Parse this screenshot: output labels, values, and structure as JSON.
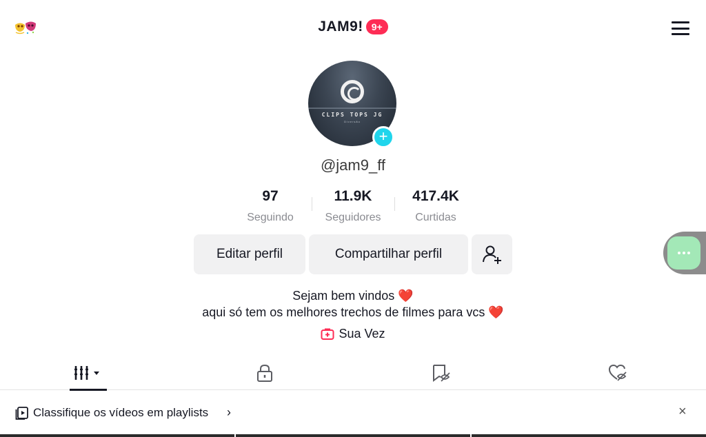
{
  "header": {
    "title": "JAM9!",
    "badge": "9+",
    "left_icon": "party-mask-icon",
    "right_icon": "hamburger-menu-icon"
  },
  "profile": {
    "avatar_text": "CLIPS TOPS JG",
    "avatar_subtext": "Diversão",
    "username": "@jam9_ff",
    "stats": [
      {
        "value": "97",
        "label": "Seguindo"
      },
      {
        "value": "11.9K",
        "label": "Seguidores"
      },
      {
        "value": "417.4K",
        "label": "Curtidas"
      }
    ],
    "buttons": {
      "edit": "Editar perfil",
      "share": "Compartilhar perfil",
      "add_friend_icon": "add-friend-icon"
    },
    "bio_line1": "Sejam bem vindos",
    "bio_line2": "aqui só tem os melhores trechos de filmes para vcs",
    "bio_emoji": "❤️",
    "link_label": "Sua Vez"
  },
  "tabs": [
    {
      "icon": "videos-grid-icon",
      "active": true
    },
    {
      "icon": "lock-icon",
      "active": false
    },
    {
      "icon": "bookmark-hidden-icon",
      "active": false
    },
    {
      "icon": "liked-hidden-icon",
      "active": false
    }
  ],
  "banner": {
    "text": "Classifique os vídeos em playlists",
    "chevron": "›",
    "close": "×"
  },
  "colors": {
    "accent": "#fe2c55",
    "avatar_plus": "#20d5ec",
    "button_bg": "#f1f1f2",
    "floating_bubble": "#a3e8b7"
  }
}
